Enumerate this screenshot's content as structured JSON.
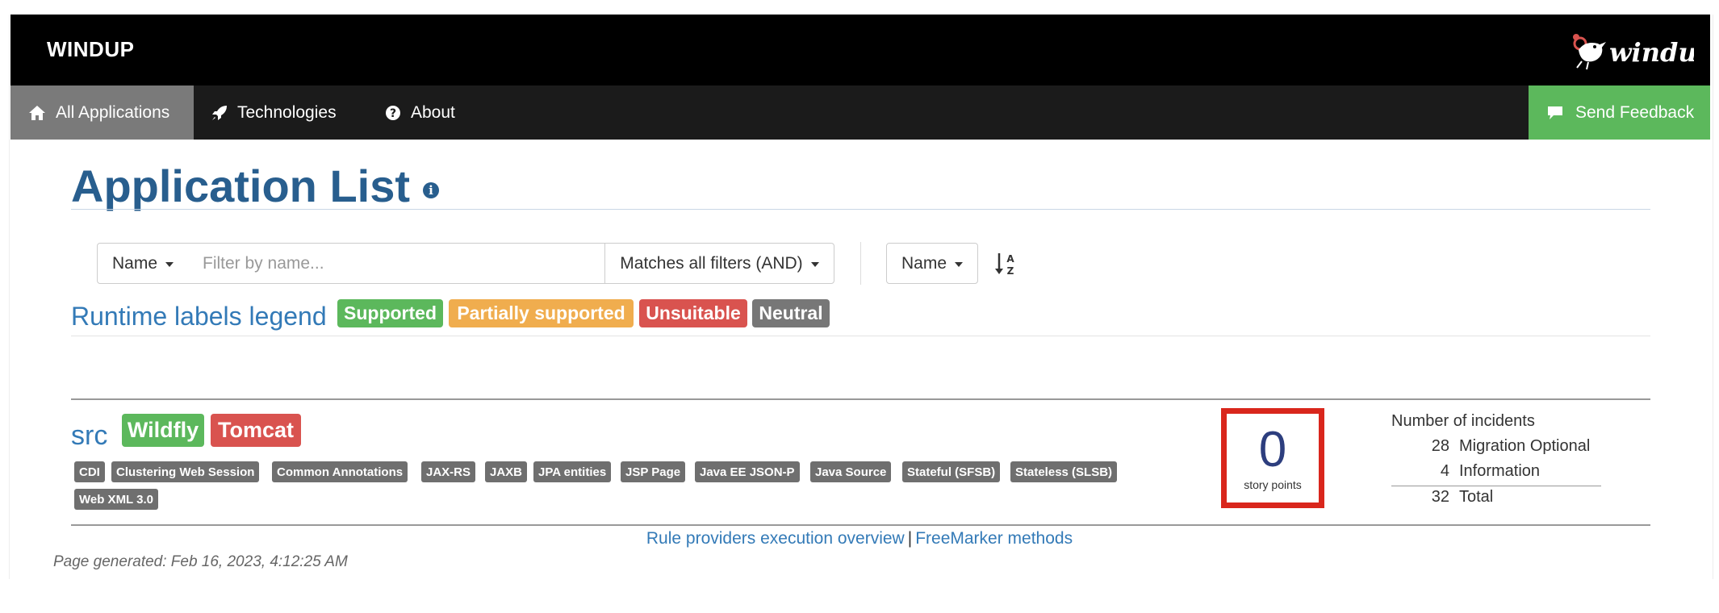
{
  "header": {
    "brand": "WINDUP",
    "logo_text": "windup"
  },
  "nav": {
    "items": [
      {
        "label": "All Applications",
        "icon": "home-icon",
        "active": true
      },
      {
        "label": "Technologies",
        "icon": "rocket-icon",
        "active": false
      },
      {
        "label": "About",
        "icon": "question-circle-icon",
        "active": false
      }
    ],
    "feedback_label": "Send Feedback",
    "feedback_icon": "comment-icon",
    "feedback_color": "#5cb85c"
  },
  "page": {
    "title": "Application List",
    "info_icon": "info-circle-icon"
  },
  "filter": {
    "field_label": "Name",
    "placeholder": "Filter by name...",
    "value": "",
    "mode_label": "Matches all filters (AND)",
    "sort_label": "Name",
    "sort_icon": "sort-alpha-asc-icon"
  },
  "legend": {
    "title": "Runtime labels legend",
    "labels": [
      {
        "text": "Supported",
        "color": "#5cb85c"
      },
      {
        "text": "Partially supported",
        "color": "#f0ad4e"
      },
      {
        "text": "Unsuitable",
        "color": "#d9534f"
      },
      {
        "text": "Neutral",
        "color": "#777777"
      }
    ]
  },
  "application": {
    "name": "src",
    "runtime_labels": [
      {
        "text": "Wildfly",
        "color": "#5cb85c"
      },
      {
        "text": "Tomcat",
        "color": "#d9534f"
      }
    ],
    "tags": [
      "CDI",
      "Clustering Web Session",
      "Common Annotations",
      "JAX-RS",
      "JAXB",
      "JPA entities",
      "JSP Page",
      "Java EE JSON-P",
      "Java Source",
      "Stateful (SFSB)",
      "Stateless (SLSB)",
      "Web XML 3.0"
    ],
    "story_points": "0",
    "story_points_label": "story points",
    "incidents": {
      "heading": "Number of incidents",
      "rows": [
        {
          "count": "28",
          "label": "Migration Optional"
        },
        {
          "count": "4",
          "label": "Information"
        }
      ],
      "total": {
        "count": "32",
        "label": "Total"
      }
    }
  },
  "footer": {
    "link1": "Rule providers execution overview",
    "separator": "|",
    "link2": "FreeMarker methods",
    "generated": "Page generated: Feb 16, 2023, 4:12:25 AM"
  }
}
